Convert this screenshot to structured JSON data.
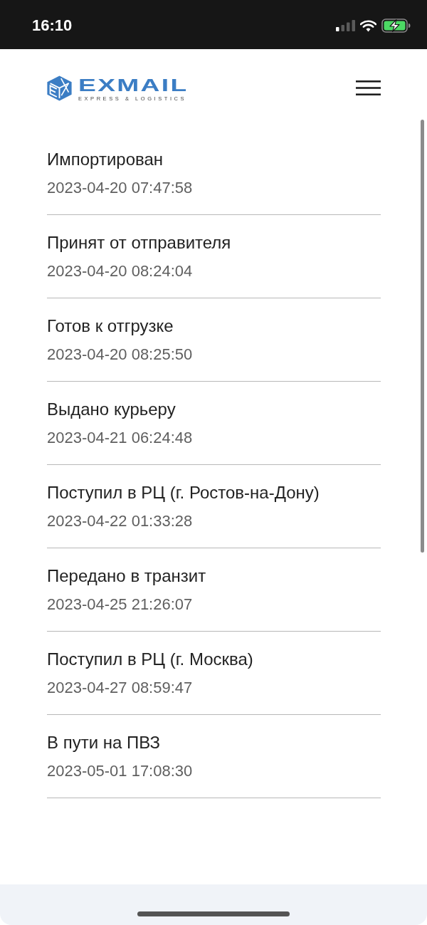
{
  "status_bar": {
    "time": "16:10",
    "battery_charging": true
  },
  "header": {
    "logo_name": "EXMAIL",
    "logo_tagline": "EXPRESS & LOGISTICS"
  },
  "tracking_events": [
    {
      "status": "Импортирован",
      "time": "2023-04-20 07:47:58"
    },
    {
      "status": "Принят от отправителя",
      "time": "2023-04-20 08:24:04"
    },
    {
      "status": "Готов к отгрузке",
      "time": "2023-04-20 08:25:50"
    },
    {
      "status": "Выдано курьеру",
      "time": "2023-04-21 06:24:48"
    },
    {
      "status": "Поступил в РЦ (г. Ростов-на-Дону)",
      "time": "2023-04-22 01:33:28"
    },
    {
      "status": "Передано в транзит",
      "time": "2023-04-25 21:26:07"
    },
    {
      "status": "Поступил в РЦ (г. Москва)",
      "time": "2023-04-27 08:59:47"
    },
    {
      "status": "В пути на ПВЗ",
      "time": "2023-05-01 17:08:30"
    }
  ]
}
